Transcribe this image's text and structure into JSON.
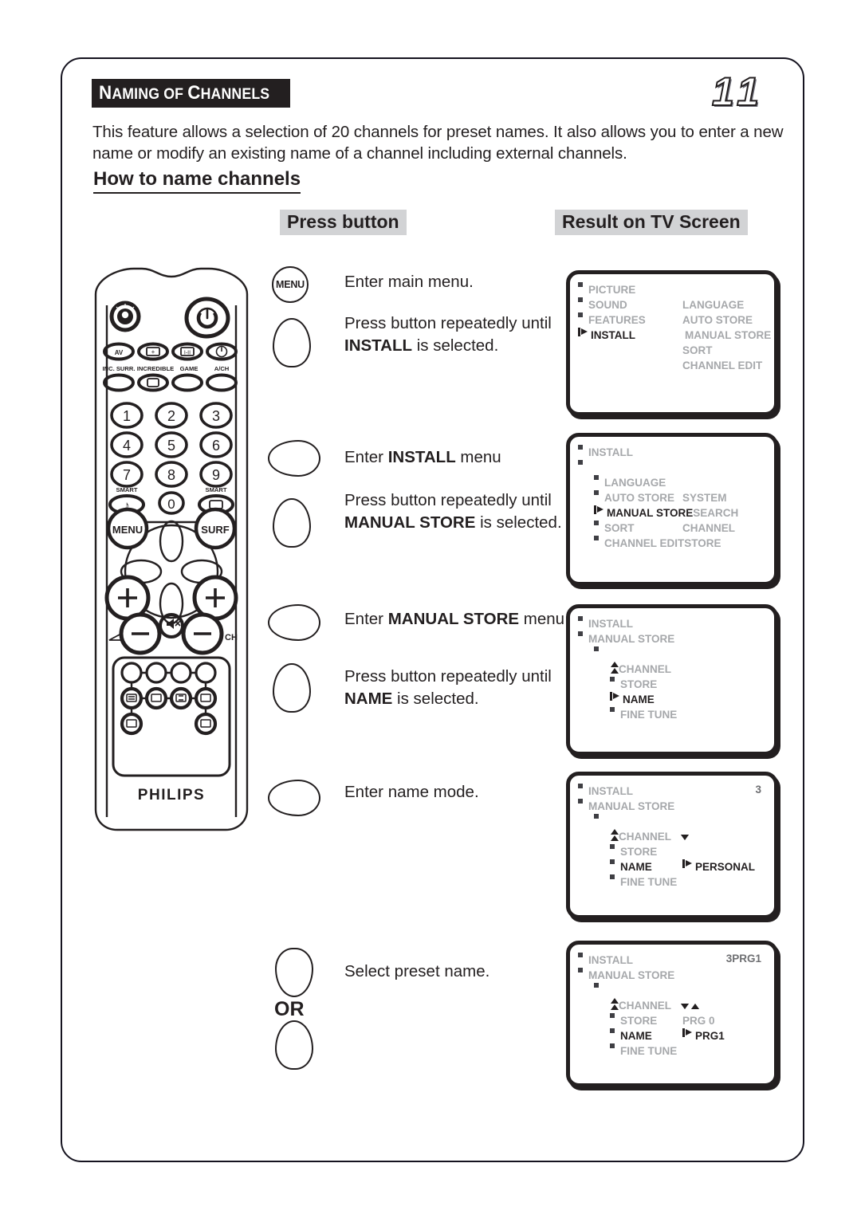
{
  "document": {
    "title": "NAMING OF CHANNELS",
    "page_number": "11",
    "intro": "This feature allows a selection of 20 channels for preset names. It also allows you to enter a new name or modify an existing name of a channel including external channels.",
    "subheading": "How to name channels"
  },
  "columns": {
    "press_button": "Press button",
    "result_on_tv": "Result on TV Screen"
  },
  "or_label": "OR",
  "steps": [
    {
      "icon": "menu-button-icon",
      "icon_label": "MENU",
      "text_html": "Enter main menu."
    },
    {
      "icon": "cursor-down-button-icon",
      "icon_label": "",
      "text_html": "Press button repeatedly until <b>INSTALL</b> is selected."
    },
    {
      "icon": "cursor-right-button-icon",
      "icon_label": "",
      "text_html": "Enter <b>INSTALL</b> menu"
    },
    {
      "icon": "cursor-down-button-icon",
      "icon_label": "",
      "text_html": "Press button repeatedly until <b>MANUAL STORE</b> is selected."
    },
    {
      "icon": "cursor-right-button-icon",
      "icon_label": "",
      "text_html": "Enter <b>MANUAL STORE</b> menu."
    },
    {
      "icon": "cursor-down-button-icon",
      "icon_label": "",
      "text_html": "Press button repeatedly until <b>NAME</b> is selected."
    },
    {
      "icon": "cursor-right-button-icon",
      "icon_label": "",
      "text_html": "Enter name mode."
    },
    {
      "icon": "cursor-up-button-icon",
      "icon_label": "",
      "text_html": "Select preset name."
    }
  ],
  "tv_screens": [
    {
      "name": "main-menu-screen",
      "rows": [
        {
          "indent": 0,
          "marker": "bullet",
          "label": "PICTURE",
          "state": "gray",
          "col2": "",
          "col2_state": "gray"
        },
        {
          "indent": 0,
          "marker": "bullet",
          "label": "SOUND",
          "state": "gray",
          "col2": "LANGUAGE",
          "col2_state": "gray"
        },
        {
          "indent": 0,
          "marker": "bullet",
          "label": "FEATURES",
          "state": "gray",
          "col2": "AUTO STORE",
          "col2_state": "gray"
        },
        {
          "indent": 0,
          "marker": "arrow",
          "label": "INSTALL",
          "state": "black",
          "col2": "MANUAL STORE",
          "col2_state": "gray"
        },
        {
          "indent": 0,
          "marker": "none",
          "label": "",
          "state": "gray",
          "col2": "SORT",
          "col2_state": "gray"
        },
        {
          "indent": 0,
          "marker": "none",
          "label": "",
          "state": "gray",
          "col2": "CHANNEL EDIT",
          "col2_state": "gray"
        }
      ]
    },
    {
      "name": "install-menu-screen",
      "rows": [
        {
          "indent": 0,
          "marker": "bullet",
          "label": "INSTALL",
          "state": "gray",
          "col2": "",
          "col2_state": "gray"
        },
        {
          "indent": 0,
          "marker": "bullet2",
          "label": "",
          "state": "gray",
          "col2": "",
          "col2_state": "gray"
        },
        {
          "indent": 1,
          "marker": "bullet",
          "label": "LANGUAGE",
          "state": "gray",
          "col2": "",
          "col2_state": "gray"
        },
        {
          "indent": 1,
          "marker": "bullet",
          "label": "AUTO STORE",
          "state": "gray",
          "col2": "SYSTEM",
          "col2_state": "gray"
        },
        {
          "indent": 1,
          "marker": "arrow",
          "label": "MANUAL STORE",
          "state": "black",
          "col2": "SEARCH",
          "col2_state": "gray"
        },
        {
          "indent": 1,
          "marker": "bullet",
          "label": "SORT",
          "state": "gray",
          "col2": "CHANNEL",
          "col2_state": "gray"
        },
        {
          "indent": 1,
          "marker": "bullet",
          "label": "CHANNEL EDIT",
          "state": "gray",
          "col2": "STORE",
          "col2_state": "gray"
        }
      ]
    },
    {
      "name": "manual-store-menu-screen",
      "rows": [
        {
          "indent": 0,
          "marker": "bullet",
          "label": "INSTALL",
          "state": "gray",
          "col2": "",
          "col2_state": "gray"
        },
        {
          "indent": 0,
          "marker": "bullet2",
          "label": "MANUAL STORE",
          "state": "gray",
          "col2": "",
          "col2_state": "gray"
        },
        {
          "indent": 1,
          "marker": "bullet2",
          "label": "",
          "state": "gray",
          "col2": "",
          "col2_state": "gray"
        },
        {
          "indent": 2,
          "marker": "updbl",
          "label": "CHANNEL",
          "state": "gray",
          "col2": "",
          "col2_state": "gray"
        },
        {
          "indent": 2,
          "marker": "bullet",
          "label": "STORE",
          "state": "gray",
          "col2": "",
          "col2_state": "gray"
        },
        {
          "indent": 2,
          "marker": "arrow",
          "label": "NAME",
          "state": "black",
          "col2": "",
          "col2_state": "gray"
        },
        {
          "indent": 2,
          "marker": "bullet",
          "label": "FINE TUNE",
          "state": "gray",
          "col2": "",
          "col2_state": "gray"
        }
      ]
    },
    {
      "name": "name-mode-screen",
      "corner_value": "3",
      "rows": [
        {
          "indent": 0,
          "marker": "bullet",
          "label": "INSTALL",
          "state": "gray",
          "col2": "",
          "col2_state": "gray"
        },
        {
          "indent": 0,
          "marker": "bullet2",
          "label": "MANUAL STORE",
          "state": "gray",
          "col2": "",
          "col2_state": "gray"
        },
        {
          "indent": 1,
          "marker": "bullet2",
          "label": "",
          "state": "gray",
          "col2": "",
          "col2_state": "gray"
        },
        {
          "indent": 2,
          "marker": "updbl",
          "label": "CHANNEL",
          "state": "gray",
          "col2": "dnarrow2",
          "col2_state": "black"
        },
        {
          "indent": 2,
          "marker": "bullet",
          "label": "STORE",
          "state": "gray",
          "col2": "",
          "col2_state": "gray"
        },
        {
          "indent": 2,
          "marker": "bullet",
          "label": "NAME",
          "state": "black",
          "col2": "PERSONAL",
          "col2_state": "black",
          "col2_marker": "arrow"
        },
        {
          "indent": 2,
          "marker": "bullet",
          "label": "FINE TUNE",
          "state": "gray",
          "col2": "",
          "col2_state": "gray"
        }
      ]
    },
    {
      "name": "preset-name-screen",
      "corner_value": "3PRG1",
      "rows": [
        {
          "indent": 0,
          "marker": "bullet",
          "label": "INSTALL",
          "state": "gray",
          "col2": "",
          "col2_state": "gray"
        },
        {
          "indent": 0,
          "marker": "bullet2",
          "label": "MANUAL STORE",
          "state": "gray",
          "col2": "",
          "col2_state": "gray"
        },
        {
          "indent": 1,
          "marker": "bullet2",
          "label": "",
          "state": "gray",
          "col2": "",
          "col2_state": "gray"
        },
        {
          "indent": 2,
          "marker": "updbl",
          "label": "CHANNEL",
          "state": "gray",
          "col2": "dnuparrow",
          "col2_state": "black"
        },
        {
          "indent": 2,
          "marker": "bullet",
          "label": "STORE",
          "state": "gray",
          "col2": "PRG 0",
          "col2_state": "gray"
        },
        {
          "indent": 2,
          "marker": "bullet",
          "label": "NAME",
          "state": "black",
          "col2": "PRG1",
          "col2_state": "black",
          "col2_marker": "arrow"
        },
        {
          "indent": 2,
          "marker": "bullet",
          "label": "FINE TUNE",
          "state": "gray",
          "col2": "",
          "col2_state": "gray"
        }
      ]
    }
  ],
  "remote": {
    "brand": "PHILIPS",
    "numeric_keys": [
      "1",
      "2",
      "3",
      "4",
      "5",
      "6",
      "7",
      "8",
      "9",
      "0"
    ],
    "function_keys": [
      "AV",
      "INCREDIBLE-SURROUND",
      "I-II",
      "STANDBY"
    ],
    "function_labels": [
      "INC. SURR.",
      "INCREDIBLE",
      "GAME",
      "A/CH"
    ],
    "smart_labels": [
      "SMART",
      "SMART"
    ],
    "menu_key": "MENU",
    "surf_key": "SURF",
    "volume_label": "◿",
    "channel_label": "CH"
  },
  "colors": {
    "ink": "#231f20",
    "osd_gray": "#a6a8ab",
    "header_gray": "#d2d3d5",
    "bullet": "#3f3f44"
  }
}
